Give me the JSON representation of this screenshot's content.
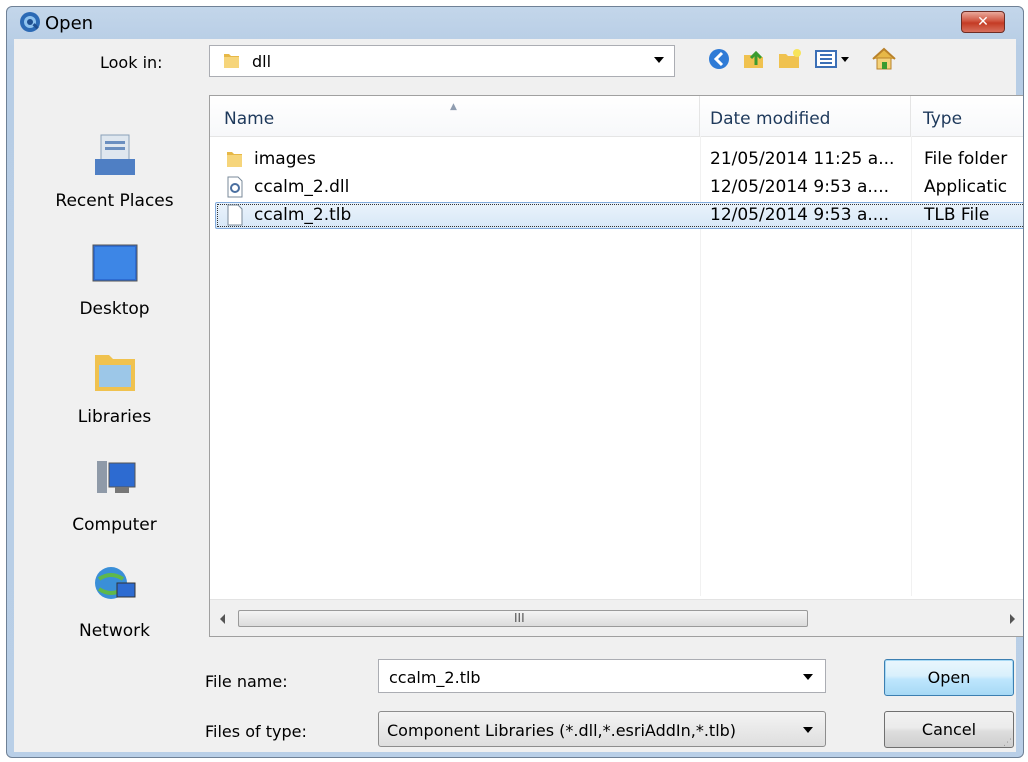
{
  "window": {
    "title": "Open",
    "close_label": "✕"
  },
  "look_in": {
    "label": "Look in:",
    "value": "dll"
  },
  "places": [
    {
      "label": "Recent Places",
      "icon": "recent-places-icon"
    },
    {
      "label": "Desktop",
      "icon": "desktop-icon"
    },
    {
      "label": "Libraries",
      "icon": "libraries-icon"
    },
    {
      "label": "Computer",
      "icon": "computer-icon"
    },
    {
      "label": "Network",
      "icon": "network-icon"
    }
  ],
  "columns": {
    "name": "Name",
    "date": "Date modified",
    "type": "Type"
  },
  "files": [
    {
      "name": "images",
      "date": "21/05/2014 11:25 a...",
      "type": "File folder",
      "icon": "folder-icon"
    },
    {
      "name": "ccalm_2.dll",
      "date": "12/05/2014 9:53 a....",
      "type": "Applicatic",
      "icon": "dll-file-icon"
    },
    {
      "name": "ccalm_2.tlb",
      "date": "12/05/2014 9:53 a....",
      "type": "TLB File",
      "icon": "file-icon",
      "selected": true
    }
  ],
  "scrollbar": {
    "grip": "III"
  },
  "file_name": {
    "label": "File name:",
    "value": "ccalm_2.tlb"
  },
  "file_type": {
    "label": "Files of type:",
    "value": "Component Libraries (*.dll,*.esriAddIn,*.tlb)"
  },
  "buttons": {
    "open": "Open",
    "cancel": "Cancel"
  },
  "colors": {
    "selection": "#d7e7f7",
    "title_bar": "#b9cfe7",
    "close": "#c43b25"
  }
}
